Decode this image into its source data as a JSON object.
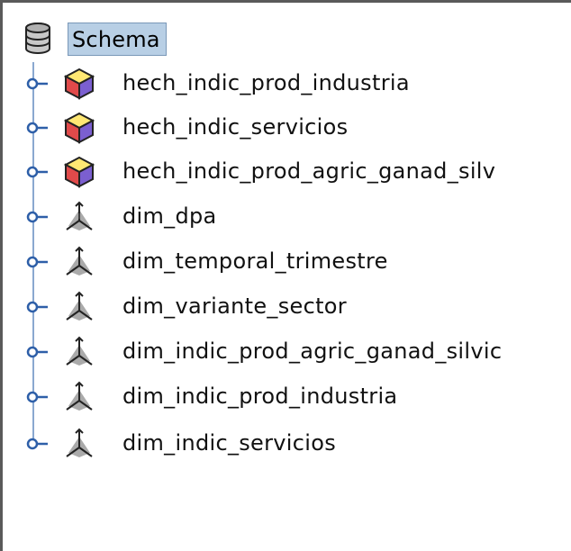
{
  "tree": {
    "root": {
      "label": "Schema",
      "icon": "database-icon"
    },
    "items": [
      {
        "label": "hech_indic_prod_industria",
        "icon": "cube-icon"
      },
      {
        "label": "hech_indic_servicios",
        "icon": "cube-icon"
      },
      {
        "label": "hech_indic_prod_agric_ganad_silv",
        "icon": "cube-icon"
      },
      {
        "label": "dim_dpa",
        "icon": "dimension-axes-icon"
      },
      {
        "label": "dim_temporal_trimestre",
        "icon": "dimension-axes-icon"
      },
      {
        "label": "dim_variante_sector",
        "icon": "dimension-axes-icon"
      },
      {
        "label": "dim_indic_prod_agric_ganad_silvic",
        "icon": "dimension-axes-icon"
      },
      {
        "label": "dim_indic_prod_industria",
        "icon": "dimension-axes-icon"
      },
      {
        "label": "dim_indic_servicios",
        "icon": "dimension-axes-icon"
      }
    ]
  },
  "colors": {
    "selection": "#b8cfe5",
    "tree_line": "#8aa8d0",
    "handle": "#2e5fa8"
  }
}
